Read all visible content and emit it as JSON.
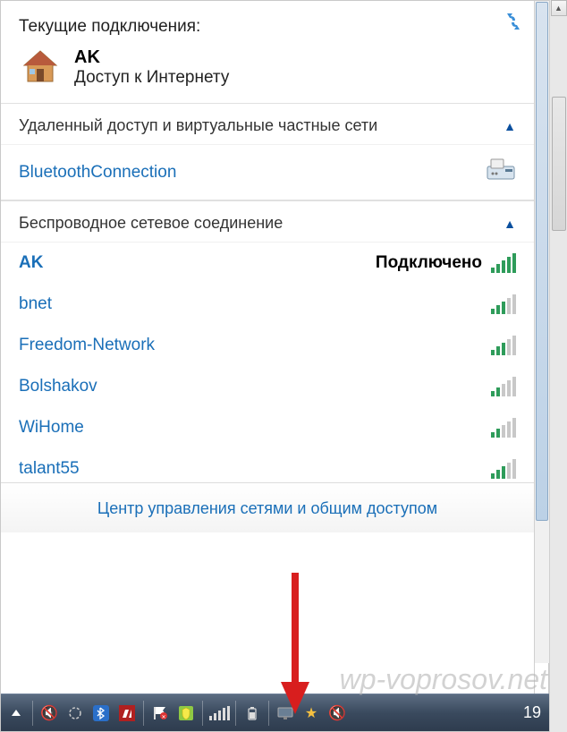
{
  "current": {
    "title": "Текущие подключения:",
    "network_name": "AK",
    "network_status": "Доступ к Интернету"
  },
  "dial_section": {
    "label": "Удаленный доступ и виртуальные частные сети",
    "items": [
      {
        "name": "BluetoothConnection",
        "icon": "fax"
      }
    ]
  },
  "wireless_section": {
    "label": "Беспроводное сетевое соединение",
    "items": [
      {
        "name": "AK",
        "status": "Подключено",
        "signal": 5
      },
      {
        "name": "bnet",
        "status": "",
        "signal": 3
      },
      {
        "name": "Freedom-Network",
        "status": "",
        "signal": 3
      },
      {
        "name": "Bolshakov",
        "status": "",
        "signal": 2
      },
      {
        "name": "WiHome",
        "status": "",
        "signal": 2
      },
      {
        "name": "talant55",
        "status": "",
        "signal": 3
      }
    ]
  },
  "footer": {
    "link": "Центр управления сетями и общим доступом"
  },
  "taskbar": {
    "time": "19"
  },
  "watermark": "wp-voprosov.net"
}
